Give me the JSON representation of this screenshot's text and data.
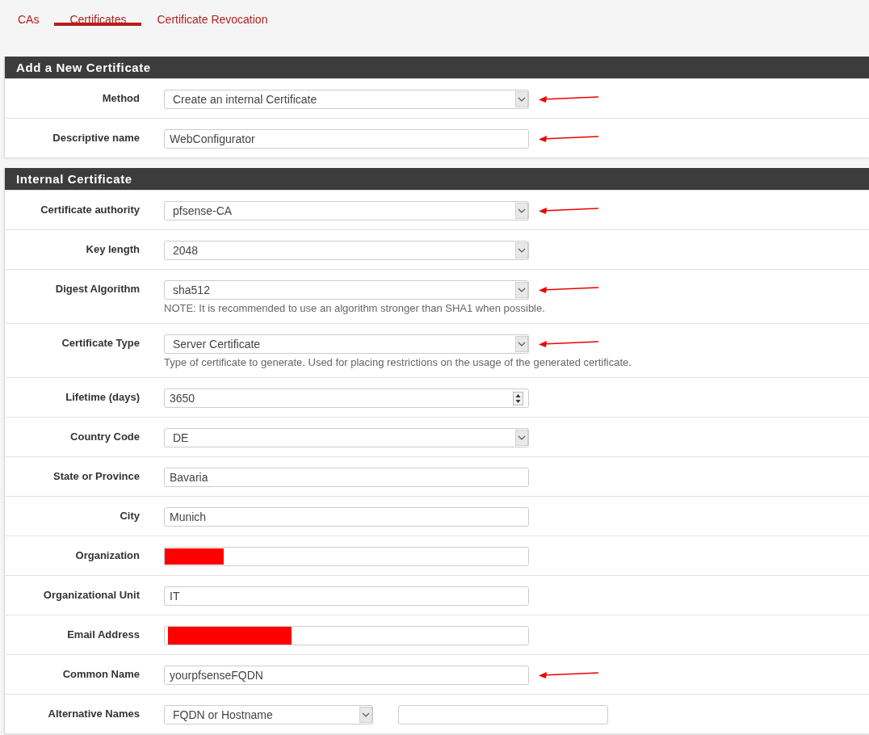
{
  "tabs": [
    {
      "label": "CAs",
      "selected": false
    },
    {
      "label": "Certificates",
      "selected": true
    },
    {
      "label": "Certificate Revocation",
      "selected": false
    }
  ],
  "sections": [
    {
      "title": "Add a New Certificate",
      "rows": [
        {
          "label": "Method",
          "kind": "select",
          "value": "Create an internal Certificate",
          "arrow": true
        },
        {
          "label": "Descriptive name",
          "kind": "text",
          "value": "WebConfigurator",
          "arrow": true
        }
      ]
    },
    {
      "title": "Internal Certificate",
      "rows": [
        {
          "label": "Certificate authority",
          "kind": "select",
          "value": "pfsense-CA",
          "arrow": true
        },
        {
          "label": "Key length",
          "kind": "select",
          "value": "2048",
          "arrow": false
        },
        {
          "label": "Digest Algorithm",
          "kind": "select",
          "value": "sha512",
          "arrow": true,
          "help": "NOTE: It is recommended to use an algorithm stronger than SHA1 when possible."
        },
        {
          "label": "Certificate Type",
          "kind": "select",
          "value": "Server Certificate",
          "arrow": true,
          "help": "Type of certificate to generate. Used for placing restrictions on the usage of the generated certificate."
        },
        {
          "label": "Lifetime (days)",
          "kind": "number",
          "value": "3650",
          "arrow": false
        },
        {
          "label": "Country Code",
          "kind": "select",
          "value": "DE",
          "arrow": false
        },
        {
          "label": "State or Province",
          "kind": "text",
          "value": "Bavaria",
          "arrow": false
        },
        {
          "label": "City",
          "kind": "text",
          "value": "Munich",
          "arrow": false
        },
        {
          "label": "Organization",
          "kind": "text",
          "redacted": true,
          "arrow": false
        },
        {
          "label": "Organizational Unit",
          "kind": "text",
          "value": "IT",
          "arrow": false
        },
        {
          "label": "Email Address",
          "kind": "text",
          "redacted": true,
          "arrow": false
        },
        {
          "label": "Common Name",
          "kind": "text",
          "value": "yourpfsenseFQDN",
          "arrow": true
        },
        {
          "label": "Alternative Names",
          "kind": "pair",
          "value": "FQDN or Hostname",
          "arrow": false
        }
      ]
    }
  ]
}
